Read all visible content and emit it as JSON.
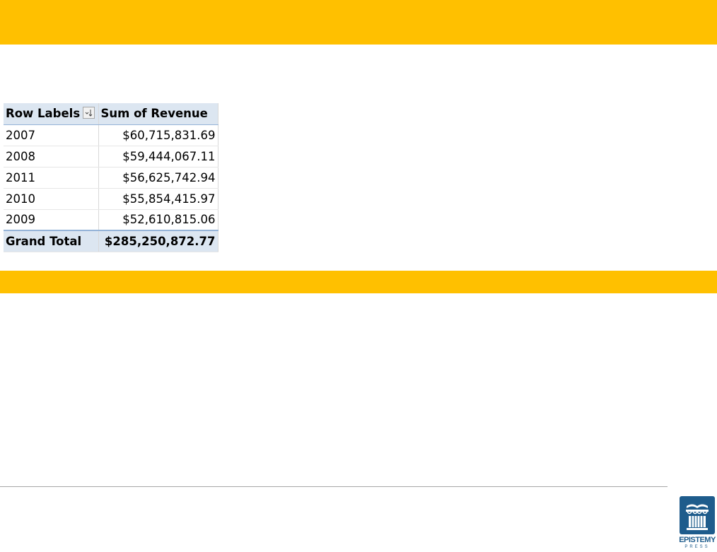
{
  "colors": {
    "band": "#FFC000",
    "pivot_header": "#DCE6F1",
    "pivot_accent": "#95B3D7",
    "logo": "#1e5c8c"
  },
  "pivot": {
    "header_row_label": "Row Labels",
    "header_value_label": "Sum of Revenue",
    "filter_icon": "sort-descending-icon",
    "rows": [
      {
        "label": "2007",
        "value": "$60,715,831.69"
      },
      {
        "label": "2008",
        "value": "$59,444,067.11"
      },
      {
        "label": "2011",
        "value": "$56,625,742.94"
      },
      {
        "label": "2010",
        "value": "$55,854,415.97"
      },
      {
        "label": "2009",
        "value": "$52,610,815.06"
      }
    ],
    "total_label": "Grand Total",
    "total_value": "$285,250,872.77"
  },
  "logo": {
    "name": "EPISTEMY",
    "sub": "PRESS",
    "icon": "column-book-icon"
  }
}
